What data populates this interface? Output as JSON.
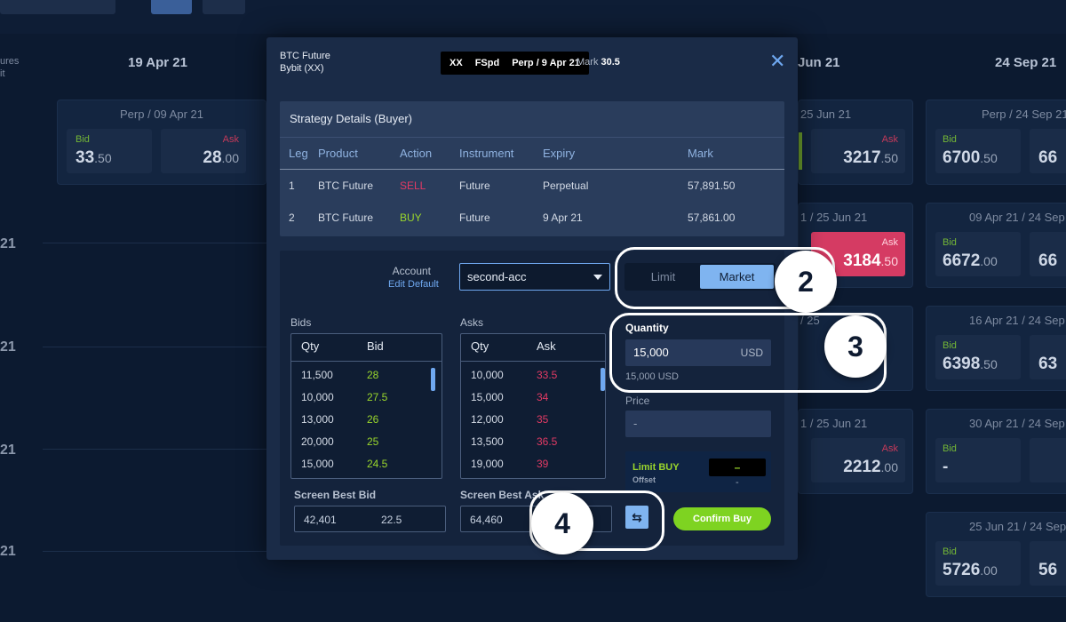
{
  "background": {
    "col_heads": [
      "19 Apr 21",
      "Jun 21",
      "24 Sep 21"
    ],
    "left_col_head": [
      "ures",
      "it"
    ],
    "row_labels": [
      "21",
      "21",
      "21",
      "21"
    ],
    "cards": [
      {
        "title": "Perp / 09 Apr 21",
        "bid_label": "Bid",
        "bid_int": "33",
        "bid_dec": ".50",
        "ask_label": "Ask",
        "ask_int": "28",
        "ask_dec": ".00"
      },
      {
        "title": "25 Jun 21",
        "ask_label": "Ask",
        "ask_int": "3217",
        "ask_dec": ".50"
      },
      {
        "title": "1 / 25 Jun 21",
        "ask_label": "Ask",
        "ask_int": "3184",
        "ask_dec": ".50"
      },
      {
        "title": "1 / 25 Jun 21",
        "ask_label": "Ask",
        "ask_int": "2212",
        "ask_dec": ".00"
      },
      {
        "title": "Perp / 24 Sep 21",
        "bid_label": "Bid",
        "bid_int": "6700",
        "bid_dec": ".50",
        "ask_int": "66"
      },
      {
        "title": "09 Apr 21 / 24 Sep",
        "bid_label": "Bid",
        "bid_int": "6672",
        "bid_dec": ".00",
        "ask_int": "66"
      },
      {
        "title": "16 Apr 21 / 24 Sep",
        "bid_label": "Bid",
        "bid_int": "6398",
        "bid_dec": ".50",
        "ask_int": "63"
      },
      {
        "title": "30 Apr 21 / 24 Sep",
        "bid_label": "Bid",
        "bid_int": "-"
      },
      {
        "title": "25 Jun 21 / 24 Sep",
        "bid_label": "Bid",
        "bid_int": "5726",
        "bid_dec": ".00",
        "ask_int": "56"
      },
      {
        "title": "/ 25",
        "title2": "/ 25"
      }
    ]
  },
  "modal": {
    "instrument": "BTC Future",
    "exchange": "Bybit (XX)",
    "pill": [
      "XX",
      "FSpd",
      "Perp / 9 Apr 21"
    ],
    "mark_label": "Mark",
    "mark_value": "30.5",
    "strategy": {
      "heading": "Strategy Details (Buyer)",
      "columns": [
        "Leg",
        "Product",
        "Action",
        "Instrument",
        "Expiry",
        "Mark"
      ],
      "rows": [
        {
          "leg": "1",
          "product": "BTC Future",
          "action": "SELL",
          "instrument": "Future",
          "expiry": "Perpetual",
          "mark": "57,891.50"
        },
        {
          "leg": "2",
          "product": "BTC Future",
          "action": "BUY",
          "instrument": "Future",
          "expiry": "9 Apr 21",
          "mark": "57,861.00"
        }
      ]
    },
    "account_label": "Account",
    "edit_default": "Edit Default",
    "account_value": "second-acc",
    "order_type": {
      "limit": "Limit",
      "market": "Market",
      "selected": "Market"
    },
    "bids": {
      "title": "Bids",
      "headers": [
        "Qty",
        "Bid"
      ],
      "rows": [
        [
          "11,500",
          "28"
        ],
        [
          "10,000",
          "27.5"
        ],
        [
          "13,000",
          "26"
        ],
        [
          "20,000",
          "25"
        ],
        [
          "15,000",
          "24.5"
        ]
      ]
    },
    "asks": {
      "title": "Asks",
      "headers": [
        "Qty",
        "Ask"
      ],
      "rows": [
        [
          "10,000",
          "33.5"
        ],
        [
          "15,000",
          "34"
        ],
        [
          "12,000",
          "35"
        ],
        [
          "13,500",
          "36.5"
        ],
        [
          "19,000",
          "39"
        ]
      ]
    },
    "quantity_label": "Quantity",
    "quantity_value": "15,000",
    "quantity_unit": "USD",
    "quantity_sub": "15,000 USD",
    "price_label": "Price",
    "price_placeholder": "-",
    "limit_buy_label": "Limit BUY",
    "offset_label": "Offset",
    "limit_value": "–",
    "offset_value": "-",
    "screen_best_bid_label": "Screen Best Bid",
    "screen_best_bid_qty": "42,401",
    "screen_best_bid_price": "22.5",
    "screen_best_ask_label": "Screen Best Ask",
    "screen_best_ask_qty": "64,460",
    "swap_icon": "⇆",
    "confirm_label": "Confirm Buy"
  },
  "callouts": [
    "2",
    "3",
    "4"
  ],
  "colors": {
    "accent": "#7fb4f0",
    "buy": "#9ad62c",
    "sell": "#e23a64",
    "confirm": "#7ed321"
  }
}
